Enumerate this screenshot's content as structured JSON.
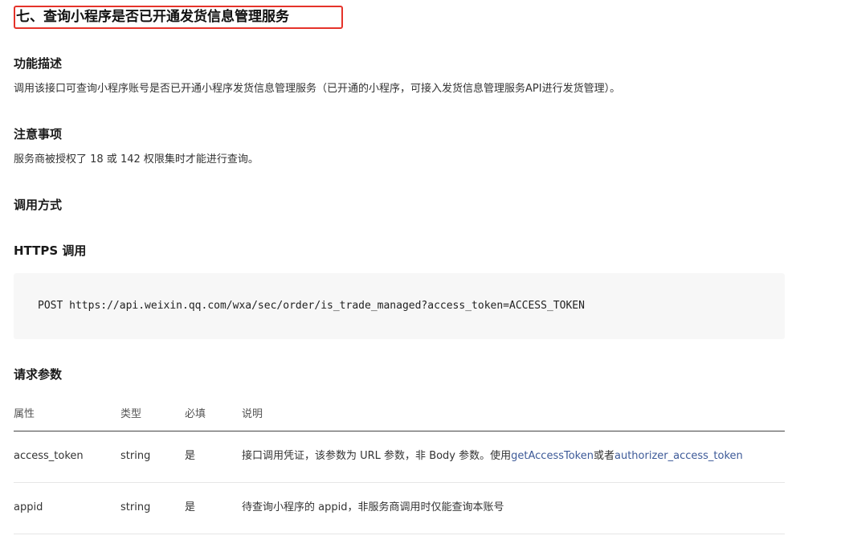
{
  "section": {
    "title": "七、查询小程序是否已开通发货信息管理服务"
  },
  "func_desc": {
    "heading": "功能描述",
    "text": "调用该接口可查询小程序账号是否已开通小程序发货信息管理服务（已开通的小程序，可接入发货信息管理服务API进行发货管理）。"
  },
  "notice": {
    "heading": "注意事项",
    "text": "服务商被授权了 18 或 142 权限集时才能进行查询。"
  },
  "call_method": {
    "heading": "调用方式"
  },
  "https": {
    "heading": "HTTPS 调用",
    "code": "POST https://api.weixin.qq.com/wxa/sec/order/is_trade_managed?access_token=ACCESS_TOKEN"
  },
  "params": {
    "heading": "请求参数",
    "columns": [
      "属性",
      "类型",
      "必填",
      "说明"
    ],
    "rows": [
      {
        "name": "access_token",
        "type": "string",
        "required": "是",
        "desc_prefix": "接口调用凭证，该参数为 URL 参数，非 Body 参数。使用",
        "link1": "getAccessToken",
        "desc_mid": "或者",
        "link2": "authorizer_access_token"
      },
      {
        "name": "appid",
        "type": "string",
        "required": "是",
        "desc": "待查询小程序的 appid，非服务商调用时仅能查询本账号"
      }
    ]
  },
  "colors": {
    "highlight_border": "#e5332a",
    "link": "#3d5a98",
    "code_bg": "#f7f7f7"
  }
}
